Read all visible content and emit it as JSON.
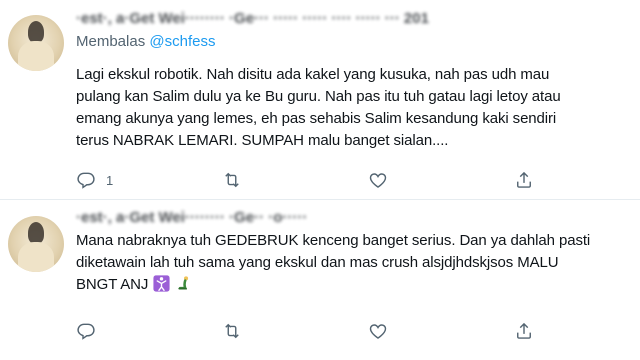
{
  "tweets": [
    {
      "header": "·est·, a·Get Wei········ ·Ge··· ····· ····· ···· ····· ··· 201",
      "reply_prefix": "Membalas",
      "reply_handle": "@schfess",
      "lines": [
        "Lagi ekskul robotik. Nah disitu ada kakel yang kusuka, nah pas udh mau",
        "pulang kan Salim dulu ya ke Bu guru. Nah pas itu tuh  gatau lagi letoy atau",
        "emang akunya yang lemes, eh pas sehabis Salim kesandung kaki sendiri",
        "terus NABRAK LEMARI. SUMPAH malu banget sialan...."
      ],
      "reply_count": "1",
      "retweet_count": "",
      "like_count": ""
    },
    {
      "header": "·est·, a·Get Wei········ ·Ge·· ·o·····",
      "lines": [
        "Mana nabraknya tuh GEDEBRUK kenceng banget serius. Dan ya dahlah pasti",
        "diketawain lah tuh sama yang ekskul dan mas crush alsjdjhdskjsos MALU",
        "BNGT ANJ"
      ],
      "reply_count": "",
      "retweet_count": "",
      "like_count": ""
    }
  ],
  "icons": {
    "reply": "reply-icon",
    "retweet": "retweet-icon",
    "like": "like-icon",
    "share": "share-icon",
    "emoji1": "person-cartwheel-emoji",
    "emoji2": "person-lying-emoji"
  },
  "colors": {
    "text": "#0f1419",
    "muted": "#536471",
    "link": "#1d9bf0",
    "divider": "#e6ecf0"
  }
}
